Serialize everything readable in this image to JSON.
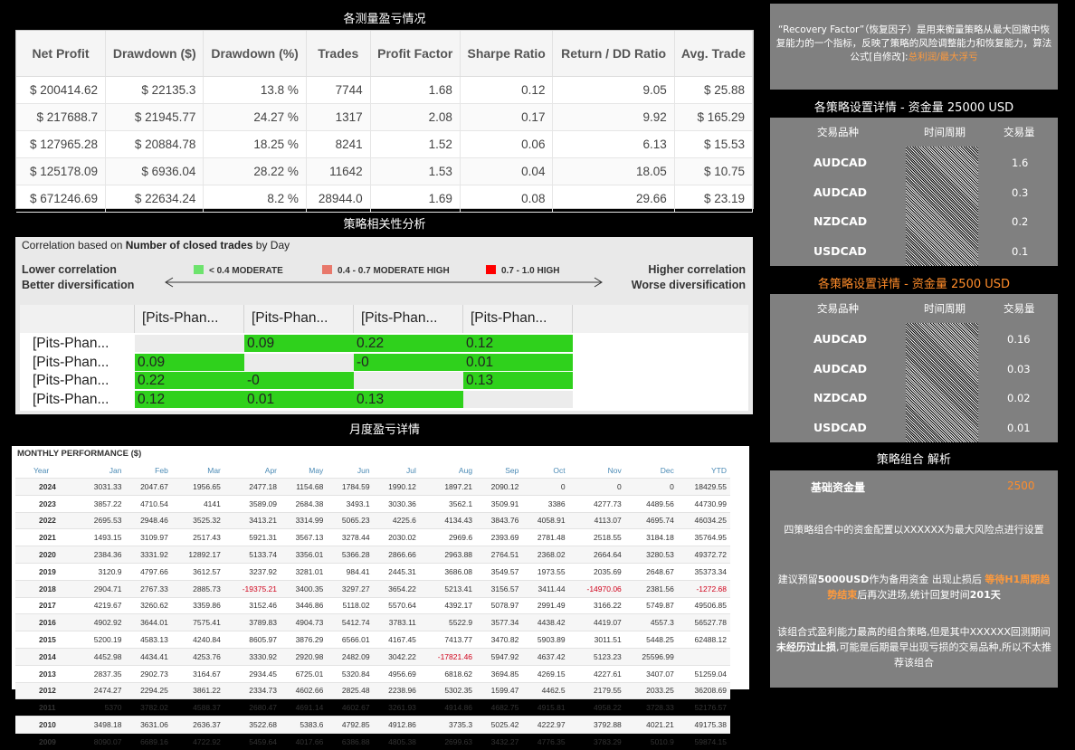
{
  "stats": {
    "title": "各测量盈亏情况",
    "headers": [
      "Net Profit",
      "Drawdown ($)",
      "Drawdown (%)",
      "Trades",
      "Profit Factor",
      "Sharpe Ratio",
      "Return / DD Ratio",
      "Avg. Trade"
    ],
    "rows": [
      [
        "$ 200414.62",
        "$ 22135.3",
        "13.8 %",
        "7744",
        "1.68",
        "0.12",
        "9.05",
        "$ 25.88"
      ],
      [
        "$ 217688.7",
        "$ 21945.77",
        "24.27 %",
        "1317",
        "2.08",
        "0.17",
        "9.92",
        "$ 165.29"
      ],
      [
        "$ 127965.28",
        "$ 20884.78",
        "18.25 %",
        "8241",
        "1.52",
        "0.06",
        "6.13",
        "$ 15.53"
      ],
      [
        "$ 125178.09",
        "$ 6936.04",
        "28.22 %",
        "11642",
        "1.53",
        "0.04",
        "18.05",
        "$ 10.75"
      ],
      [
        "$ 671246.69",
        "$ 22634.24",
        "8.2 %",
        "28944.0",
        "1.69",
        "0.08",
        "29.66",
        "$ 23.19"
      ]
    ]
  },
  "correlation": {
    "title": "策略相关性分析",
    "subtitle_prefix": "Correlation based on",
    "subtitle_bold": "Number of closed trades",
    "subtitle_suffix": "by Day",
    "left_legend_1": "Lower correlation",
    "left_legend_2": "Better diversification",
    "right_legend_1": "Higher correlation",
    "right_legend_2": "Worse diversification",
    "legend": [
      {
        "label": "< 0.4 MODERATE",
        "color": "#6de36d"
      },
      {
        "label": "0.4 - 0.7 MODERATE HIGH",
        "color": "#e8786b"
      },
      {
        "label": "0.7 - 1.0 HIGH",
        "color": "#ff0000"
      }
    ],
    "headers": [
      "[Pits-Phan...",
      "[Pits-Phan...",
      "[Pits-Phan...",
      "[Pits-Phan..."
    ],
    "rows": [
      {
        "label": "[Pits-Phan...",
        "cells": [
          "",
          "0.09",
          "0.22",
          "0.12"
        ]
      },
      {
        "label": "[Pits-Phan...",
        "cells": [
          "0.09",
          "",
          "-0",
          "0.01"
        ]
      },
      {
        "label": "[Pits-Phan...",
        "cells": [
          "0.22",
          "-0",
          "",
          "0.13"
        ]
      },
      {
        "label": "[Pits-Phan...",
        "cells": [
          "0.12",
          "0.01",
          "0.13",
          ""
        ]
      }
    ],
    "cell_color": "#2fd11c",
    "empty_color": "#ececec"
  },
  "monthly": {
    "section_title": "月度盈亏详情",
    "panel_title": "MONTHLY PERFORMANCE ($)",
    "headers": [
      "Year",
      "Jan",
      "Feb",
      "Mar",
      "Apr",
      "May",
      "Jun",
      "Jul",
      "Aug",
      "Sep",
      "Oct",
      "Nov",
      "Dec",
      "YTD"
    ],
    "rows": [
      [
        "2024",
        "3031.33",
        "2047.67",
        "1956.65",
        "2477.18",
        "1154.68",
        "1784.59",
        "1990.12",
        "1897.21",
        "2090.12",
        "0",
        "0",
        "0",
        "18429.55"
      ],
      [
        "2023",
        "3857.22",
        "4710.54",
        "4141",
        "3589.09",
        "2684.38",
        "3493.1",
        "3030.36",
        "3562.1",
        "3509.91",
        "3386",
        "4277.73",
        "4489.56",
        "44730.99"
      ],
      [
        "2022",
        "2695.53",
        "2948.46",
        "3525.32",
        "3413.21",
        "3314.99",
        "5065.23",
        "4225.6",
        "4134.43",
        "3843.76",
        "4058.91",
        "4113.07",
        "4695.74",
        "46034.25"
      ],
      [
        "2021",
        "1493.15",
        "3109.97",
        "2517.43",
        "5921.31",
        "3567.13",
        "3278.44",
        "2030.02",
        "2969.6",
        "2393.69",
        "2781.48",
        "2518.55",
        "3184.18",
        "35764.95"
      ],
      [
        "2020",
        "2384.36",
        "3331.92",
        "12892.17",
        "5133.74",
        "3356.01",
        "5366.28",
        "2866.66",
        "2963.88",
        "2764.51",
        "2368.02",
        "2664.64",
        "3280.53",
        "49372.72"
      ],
      [
        "2019",
        "3120.9",
        "4797.66",
        "3612.57",
        "3237.92",
        "3281.01",
        "984.41",
        "2445.31",
        "3686.08",
        "3549.57",
        "1973.55",
        "2035.69",
        "2648.67",
        "35373.34"
      ],
      [
        "2018",
        "2904.71",
        "2767.33",
        "2885.73",
        "-19375.21",
        "3400.35",
        "3297.27",
        "3654.22",
        "5213.41",
        "3156.57",
        "3411.44",
        "-14970.06",
        "2381.56",
        "-1272.68"
      ],
      [
        "2017",
        "4219.67",
        "3260.62",
        "3359.86",
        "3152.46",
        "3446.86",
        "5118.02",
        "5570.64",
        "4392.17",
        "5078.97",
        "2991.49",
        "3166.22",
        "5749.87",
        "49506.85"
      ],
      [
        "2016",
        "4902.92",
        "3644.01",
        "7575.41",
        "3789.83",
        "4904.73",
        "5412.74",
        "3783.11",
        "5522.9",
        "3577.34",
        "4438.42",
        "4419.07",
        "4557.3",
        "56527.78"
      ],
      [
        "2015",
        "5200.19",
        "4583.13",
        "4240.84",
        "8605.97",
        "3876.29",
        "6566.01",
        "4167.45",
        "7413.77",
        "3470.82",
        "5903.89",
        "3011.51",
        "5448.25",
        "62488.12"
      ],
      [
        "2014",
        "4452.98",
        "4434.41",
        "4253.76",
        "3330.92",
        "2920.98",
        "2482.09",
        "3042.22",
        "-17821.46",
        "5947.92",
        "4637.42",
        "5123.23",
        "25596.99",
        ""
      ],
      [
        "2013",
        "2837.35",
        "2902.73",
        "3164.67",
        "2934.45",
        "6725.01",
        "5320.84",
        "4956.69",
        "6818.62",
        "3694.85",
        "4269.15",
        "4227.61",
        "3407.07",
        "51259.04"
      ],
      [
        "2012",
        "2474.27",
        "2294.25",
        "3861.22",
        "2334.73",
        "4602.66",
        "2825.48",
        "2238.96",
        "5302.35",
        "1599.47",
        "4462.5",
        "2179.55",
        "2033.25",
        "36208.69"
      ],
      [
        "2011",
        "5370",
        "3782.02",
        "4588.37",
        "2680.47",
        "4691.14",
        "4602.67",
        "3261.93",
        "4914.86",
        "4682.75",
        "4915.81",
        "4958.22",
        "3728.33",
        "52176.57"
      ],
      [
        "2010",
        "3498.18",
        "3631.06",
        "2636.37",
        "3522.68",
        "5383.6",
        "4792.85",
        "4912.86",
        "3735.3",
        "5025.42",
        "4222.97",
        "3792.88",
        "4021.21",
        "49175.38"
      ],
      [
        "2009",
        "8090.07",
        "6689.16",
        "4722.92",
        "5459.64",
        "4017.66",
        "6386.88",
        "4805.38",
        "2699.63",
        "3432.27",
        "4776.35",
        "3783.29",
        "5010.9",
        "59874.15"
      ]
    ]
  },
  "recovery": {
    "text_main": "“Recovery Factor”（恢复因子）是用来衡量策略从最大回撤中恢复能力的一个指标，反映了策略的风险调整能力和恢复能力，算法公式[自修改]:",
    "formula": "总利润/最大浮亏"
  },
  "alloc1": {
    "title": "各策略设置详情 - 资金量 25000 USD",
    "title_color": "#ffffff",
    "col_symbol": "交易品种",
    "col_timeframe": "时间周期",
    "col_lots": "交易量",
    "rows": [
      {
        "symbol": "AUDCAD",
        "lots": "1.6"
      },
      {
        "symbol": "AUDCAD",
        "lots": "0.3"
      },
      {
        "symbol": "NZDCAD",
        "lots": "0.2"
      },
      {
        "symbol": "USDCAD",
        "lots": "0.1"
      }
    ]
  },
  "alloc2": {
    "title": "各策略设置详情 - 资金量 2500 USD",
    "title_color": "#ff8c2a",
    "col_symbol": "交易品种",
    "col_timeframe": "时间周期",
    "col_lots": "交易量",
    "rows": [
      {
        "symbol": "AUDCAD",
        "lots": "0.16"
      },
      {
        "symbol": "AUDCAD",
        "lots": "0.03"
      },
      {
        "symbol": "NZDCAD",
        "lots": "0.02"
      },
      {
        "symbol": "USDCAD",
        "lots": "0.01"
      }
    ]
  },
  "combo": {
    "title": "策略组合 解析",
    "capital_label": "基础资金量",
    "capital_value": "2500",
    "p1": "四策略组合中的资金配置以XXXXXX为最大风险点进行设置",
    "p2_a": "建议预留",
    "p2_b": "5000USD",
    "p2_c": "作为备用资金 出现止损后 ",
    "p2_d": "等待H1周期趋势结束",
    "p2_e": "后再次进场,统计回复时间",
    "p2_f": "201天",
    "p3_a": "该组合式盈利能力最高的组合策略,但是其中XXXXXX回测期间",
    "p3_b": "未经历过止损",
    "p3_c": ",可能是后期最早出现亏损的交易品种,所以不太推荐该组合"
  }
}
